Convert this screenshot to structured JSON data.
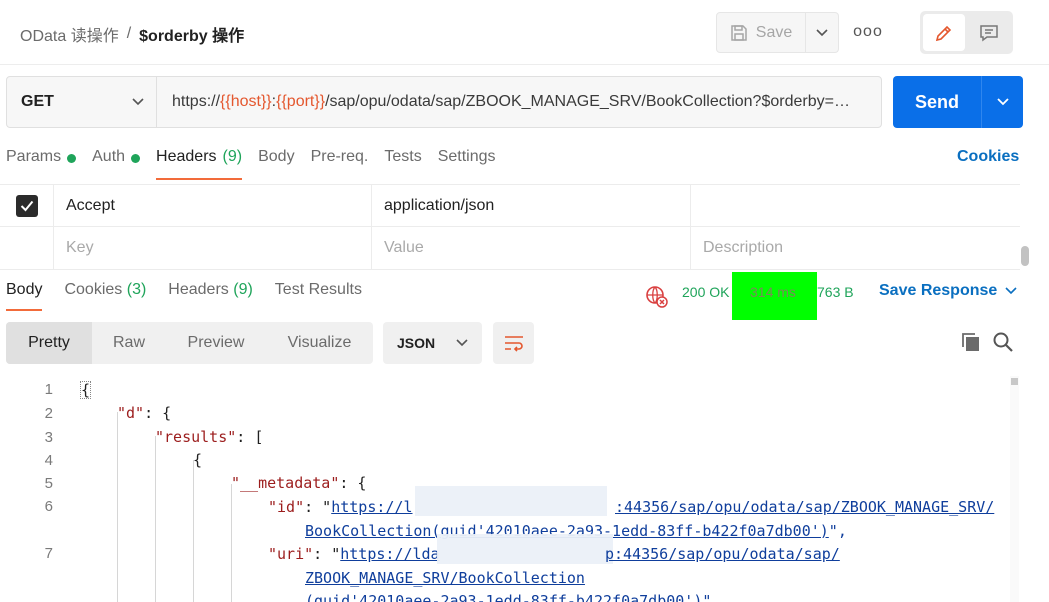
{
  "header": {
    "breadcrumb_collection": "OData 读操作",
    "breadcrumb_sep": "/",
    "breadcrumb_request": "$orderby 操作",
    "save_label": "Save",
    "more_label": "ooo"
  },
  "request": {
    "method": "GET",
    "url_prefix": "https://",
    "url_var_host": "{{host}}",
    "url_colon": ":",
    "url_var_port": "{{port}}",
    "url_rest": "/sap/opu/odata/sap/ZBOOK_MANAGE_SRV/BookCollection?$orderby=…",
    "send_label": "Send"
  },
  "request_tabs": [
    {
      "label": "Params",
      "dot": true
    },
    {
      "label": "Auth",
      "dot": true
    },
    {
      "label": "Headers",
      "count": "(9)",
      "active": true
    },
    {
      "label": "Body"
    },
    {
      "label": "Pre-req."
    },
    {
      "label": "Tests"
    },
    {
      "label": "Settings"
    }
  ],
  "cookies_link": "Cookies",
  "headers_table": {
    "row1": {
      "key": "Accept",
      "value": "application/json",
      "checked": true
    },
    "placeholder": {
      "key": "Key",
      "value": "Value",
      "description": "Description"
    }
  },
  "response_tabs": [
    {
      "label": "Body",
      "active": true
    },
    {
      "label": "Cookies",
      "count": "(3)"
    },
    {
      "label": "Headers",
      "count": "(9)"
    },
    {
      "label": "Test Results"
    }
  ],
  "response_status": {
    "status": "200 OK",
    "time": "314 ms",
    "size": "763 B",
    "save_response": "Save Response"
  },
  "view_options": [
    "Pretty",
    "Raw",
    "Preview",
    "Visualize"
  ],
  "format": "JSON",
  "code_lines": {
    "n1": "1",
    "n2": "2",
    "n3": "3",
    "n4": "4",
    "n5": "5",
    "n6": "6",
    "n7": "7",
    "l1": "{",
    "l2_key": "\"d\"",
    "l2_rest": ": {",
    "l3_key": "\"results\"",
    "l3_rest": ": [",
    "l4": "{",
    "l5_key": "\"__metadata\"",
    "l5_rest": ": {",
    "l6_key": "\"id\"",
    "l6_colon": ": \"",
    "l6_url_a": "https://l",
    "l6_url_b": ":44356/sap/opu/odata/sap/ZBOOK_MANAGE_SRV/",
    "l6_wrap": "BookCollection(guid'42010aee-2a93-1edd-83ff-b422f0a7db00')",
    "l6_end": "\",",
    "l7_key": "\"uri\"",
    "l7_colon": ": \"",
    "l7_url_a": "https://lda",
    "l7_url_b": "p:44356/sap/opu/odata/sap/",
    "l7_wrap1": "ZBOOK_MANAGE_SRV/BookCollection",
    "l7_wrap2": "(guid'42010aee-2a93-1edd-83ff-b422f0a7db00')",
    "l7_end": "\","
  },
  "colors": {
    "send": "#0a6fe8",
    "accent_tab": "#f26b3a",
    "status_ok": "#1fa45a",
    "highlight": "#00ff00",
    "link": "#0a6fc0"
  }
}
